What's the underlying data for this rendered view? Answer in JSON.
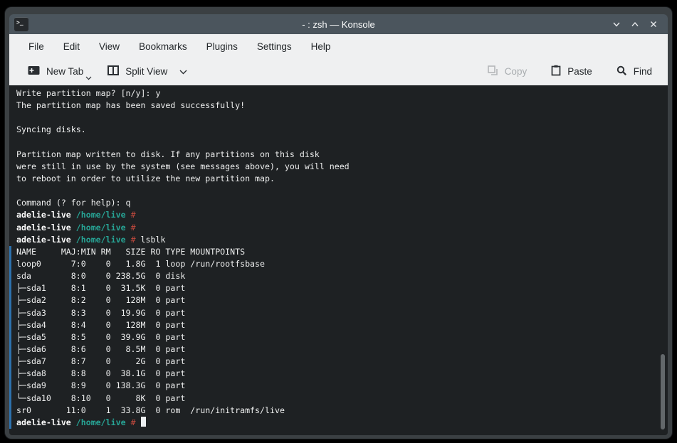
{
  "window": {
    "title": "- : zsh — Konsole"
  },
  "menubar": {
    "items": [
      "File",
      "Edit",
      "View",
      "Bookmarks",
      "Plugins",
      "Settings",
      "Help"
    ]
  },
  "toolbar": {
    "new_tab": "New Tab",
    "split_view": "Split View",
    "copy": "Copy",
    "paste": "Paste",
    "find": "Find"
  },
  "icons": [
    "konsole-app-icon",
    "minimize-icon",
    "maximize-icon",
    "close-icon",
    "new-tab-icon",
    "chevron-down-icon",
    "split-view-icon",
    "copy-icon",
    "paste-icon",
    "search-icon"
  ],
  "colors": {
    "titlebar": "#4b555d",
    "chrome": "#eff0f1",
    "uitext": "#24282b",
    "termbg": "#1e2123",
    "termfg": "#eeefef",
    "teal": "#27a596",
    "red": "#c34a3e",
    "hlbar": "#2d71ad",
    "cursor": "#eceff1"
  },
  "terminal": {
    "lines": [
      {
        "hl": false,
        "seg": [
          {
            "t": "Write partition map? [n/y]: y",
            "c": "fg"
          }
        ]
      },
      {
        "hl": false,
        "seg": [
          {
            "t": "The partition map has been saved successfully!",
            "c": "fg"
          }
        ]
      },
      {
        "hl": false,
        "seg": [
          {
            "t": "",
            "c": "fg"
          }
        ]
      },
      {
        "hl": false,
        "seg": [
          {
            "t": "Syncing disks.",
            "c": "fg"
          }
        ]
      },
      {
        "hl": false,
        "seg": [
          {
            "t": "",
            "c": "fg"
          }
        ]
      },
      {
        "hl": false,
        "seg": [
          {
            "t": "Partition map written to disk. If any partitions on this disk",
            "c": "fg"
          }
        ]
      },
      {
        "hl": false,
        "seg": [
          {
            "t": "were still in use by the system (see messages above), you will need",
            "c": "fg"
          }
        ]
      },
      {
        "hl": false,
        "seg": [
          {
            "t": "to reboot in order to utilize the new partition map.",
            "c": "fg"
          }
        ]
      },
      {
        "hl": false,
        "seg": [
          {
            "t": "",
            "c": "fg"
          }
        ]
      },
      {
        "hl": false,
        "seg": [
          {
            "t": "Command (? for help): q",
            "c": "fg"
          }
        ]
      },
      {
        "hl": false,
        "seg": [
          {
            "t": "adelie-live",
            "c": "b"
          },
          {
            "t": " ",
            "c": "fg"
          },
          {
            "t": "/home/live",
            "c": "teal"
          },
          {
            "t": " ",
            "c": "fg"
          },
          {
            "t": "#",
            "c": "red"
          }
        ]
      },
      {
        "hl": false,
        "seg": [
          {
            "t": "adelie-live",
            "c": "b"
          },
          {
            "t": " ",
            "c": "fg"
          },
          {
            "t": "/home/live",
            "c": "teal"
          },
          {
            "t": " ",
            "c": "fg"
          },
          {
            "t": "#",
            "c": "red"
          }
        ]
      },
      {
        "hl": false,
        "seg": [
          {
            "t": "adelie-live",
            "c": "b"
          },
          {
            "t": " ",
            "c": "fg"
          },
          {
            "t": "/home/live",
            "c": "teal"
          },
          {
            "t": " ",
            "c": "fg"
          },
          {
            "t": "#",
            "c": "red"
          },
          {
            "t": " lsblk",
            "c": "fg"
          }
        ]
      },
      {
        "hl": true,
        "seg": [
          {
            "t": "NAME     MAJ:MIN RM   SIZE RO TYPE MOUNTPOINTS",
            "c": "fg"
          }
        ]
      },
      {
        "hl": true,
        "seg": [
          {
            "t": "loop0      7:0    0   1.8G  1 loop /run/rootfsbase",
            "c": "fg"
          }
        ]
      },
      {
        "hl": true,
        "seg": [
          {
            "t": "sda        8:0    0 238.5G  0 disk ",
            "c": "fg"
          }
        ]
      },
      {
        "hl": true,
        "seg": [
          {
            "t": "├─sda1     8:1    0  31.5K  0 part ",
            "c": "fg"
          }
        ]
      },
      {
        "hl": true,
        "seg": [
          {
            "t": "├─sda2     8:2    0   128M  0 part ",
            "c": "fg"
          }
        ]
      },
      {
        "hl": true,
        "seg": [
          {
            "t": "├─sda3     8:3    0  19.9G  0 part ",
            "c": "fg"
          }
        ]
      },
      {
        "hl": true,
        "seg": [
          {
            "t": "├─sda4     8:4    0   128M  0 part ",
            "c": "fg"
          }
        ]
      },
      {
        "hl": true,
        "seg": [
          {
            "t": "├─sda5     8:5    0  39.9G  0 part ",
            "c": "fg"
          }
        ]
      },
      {
        "hl": true,
        "seg": [
          {
            "t": "├─sda6     8:6    0   8.5M  0 part ",
            "c": "fg"
          }
        ]
      },
      {
        "hl": true,
        "seg": [
          {
            "t": "├─sda7     8:7    0     2G  0 part ",
            "c": "fg"
          }
        ]
      },
      {
        "hl": true,
        "seg": [
          {
            "t": "├─sda8     8:8    0  38.1G  0 part ",
            "c": "fg"
          }
        ]
      },
      {
        "hl": true,
        "seg": [
          {
            "t": "├─sda9     8:9    0 138.3G  0 part ",
            "c": "fg"
          }
        ]
      },
      {
        "hl": true,
        "seg": [
          {
            "t": "└─sda10    8:10   0     8K  0 part ",
            "c": "fg"
          }
        ]
      },
      {
        "hl": true,
        "seg": [
          {
            "t": "sr0       11:0    1  33.8G  0 rom  /run/initramfs/live",
            "c": "fg"
          }
        ]
      },
      {
        "hl": true,
        "cursor": true,
        "seg": [
          {
            "t": "adelie-live",
            "c": "b"
          },
          {
            "t": " ",
            "c": "fg"
          },
          {
            "t": "/home/live",
            "c": "teal"
          },
          {
            "t": " ",
            "c": "fg"
          },
          {
            "t": "#",
            "c": "red"
          },
          {
            "t": " ",
            "c": "fg"
          }
        ]
      }
    ]
  }
}
